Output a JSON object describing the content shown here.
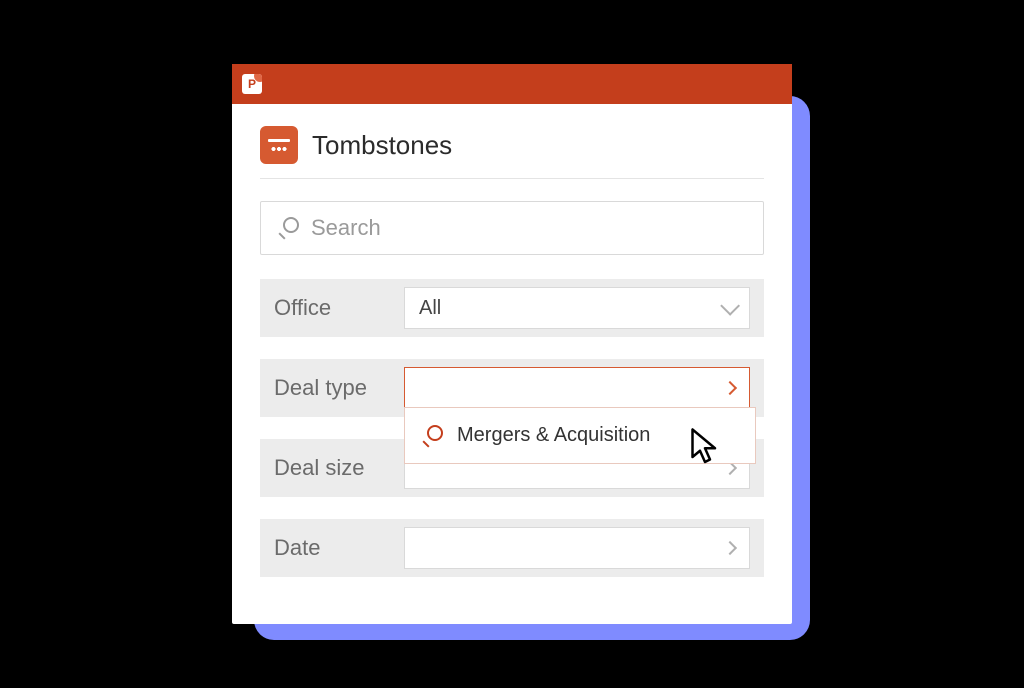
{
  "app": {
    "badge_letter": "P"
  },
  "panel": {
    "title": "Tombstones",
    "search_placeholder": "Search"
  },
  "filters": {
    "office": {
      "label": "Office",
      "value": "All"
    },
    "deal_type": {
      "label": "Deal type",
      "value": "",
      "options": [
        "Mergers & Acquisition"
      ]
    },
    "deal_size": {
      "label": "Deal size",
      "value": ""
    },
    "date": {
      "label": "Date",
      "value": ""
    }
  }
}
